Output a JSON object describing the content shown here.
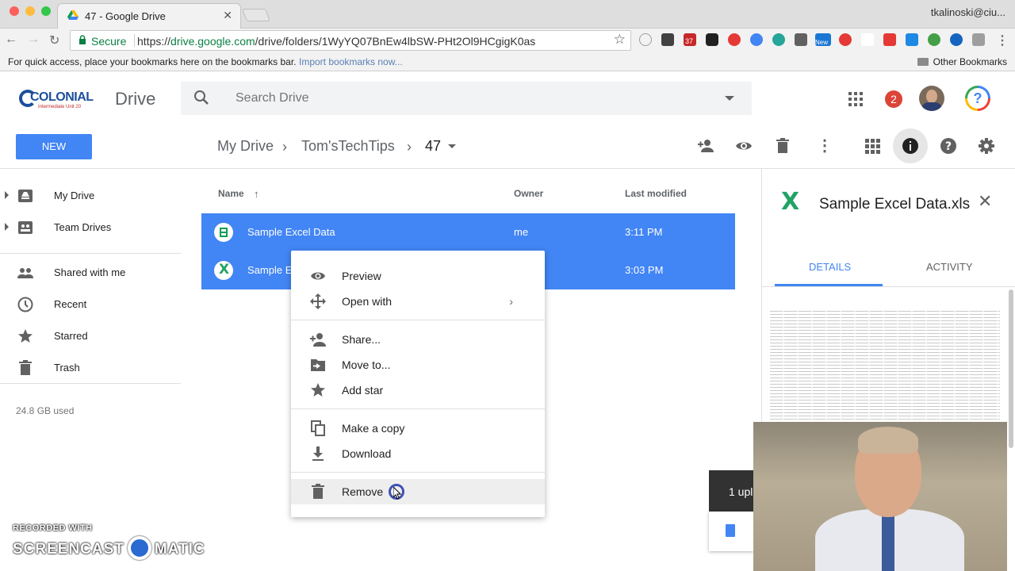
{
  "browser": {
    "tab_title": "47 - Google Drive",
    "user": "tkalinoski@ciu...",
    "secure_label": "Secure",
    "url_scheme": "https://",
    "url_host": "drive.google.com",
    "url_path": "/drive/folders/1WyYQ07BnEw4lbSW-PHt2Ol9HCgigK0as",
    "bookmarks_prompt": "For quick access, place your bookmarks here on the bookmarks bar.",
    "import_link": "Import bookmarks now...",
    "other_bookmarks": "Other Bookmarks",
    "ext_badge": "37",
    "ext_new": "New"
  },
  "header": {
    "logo_text": "COLONIAL",
    "logo_sub": "Intermediate Unit 20",
    "product": "Drive",
    "search_placeholder": "Search Drive",
    "notifications": "2",
    "help_glyph": "?"
  },
  "toolbar": {
    "new_label": "NEW",
    "breadcrumb": [
      "My Drive",
      "Tom'sTechTips",
      "47"
    ],
    "sep": "›"
  },
  "sidebar": {
    "items": [
      {
        "label": "My Drive",
        "icon": "drive-icon"
      },
      {
        "label": "Team Drives",
        "icon": "team-drives-icon"
      },
      {
        "label": "Shared with me",
        "icon": "people-icon"
      },
      {
        "label": "Recent",
        "icon": "clock-icon"
      },
      {
        "label": "Starred",
        "icon": "star-icon"
      },
      {
        "label": "Trash",
        "icon": "trash-icon"
      }
    ],
    "storage": "24.8 GB used"
  },
  "list": {
    "headers": {
      "name": "Name",
      "owner": "Owner",
      "modified": "Last modified"
    },
    "sort_glyph": "↑",
    "rows": [
      {
        "name": "Sample Excel Data",
        "owner": "me",
        "modified": "3:11 PM",
        "icon": "sheets-icon"
      },
      {
        "name": "Sample E",
        "owner": "",
        "modified": "3:03 PM",
        "icon": "excel-icon"
      }
    ]
  },
  "context_menu": {
    "items": [
      {
        "label": "Preview",
        "icon": "eye-icon"
      },
      {
        "label": "Open with",
        "icon": "move-arrows-icon",
        "submenu": "›"
      },
      {
        "label": "Share...",
        "icon": "add-person-icon"
      },
      {
        "label": "Move to...",
        "icon": "folder-move-icon"
      },
      {
        "label": "Add star",
        "icon": "star-icon"
      },
      {
        "label": "Make a copy",
        "icon": "copy-icon"
      },
      {
        "label": "Download",
        "icon": "download-icon"
      },
      {
        "label": "Remove",
        "icon": "trash-icon"
      }
    ]
  },
  "details": {
    "glyph": "X",
    "title": "Sample Excel Data.xls",
    "close": "✕",
    "tabs": [
      "DETAILS",
      "ACTIVITY"
    ]
  },
  "toast": {
    "text": "1 upl"
  },
  "watermark": {
    "line1": "RECORDED WITH",
    "line2_a": "SCREENCAST",
    "line2_b": "MATIC"
  },
  "colors": {
    "accent": "#4285f4",
    "excel_green": "#21a366",
    "alert_red": "#db4437"
  }
}
